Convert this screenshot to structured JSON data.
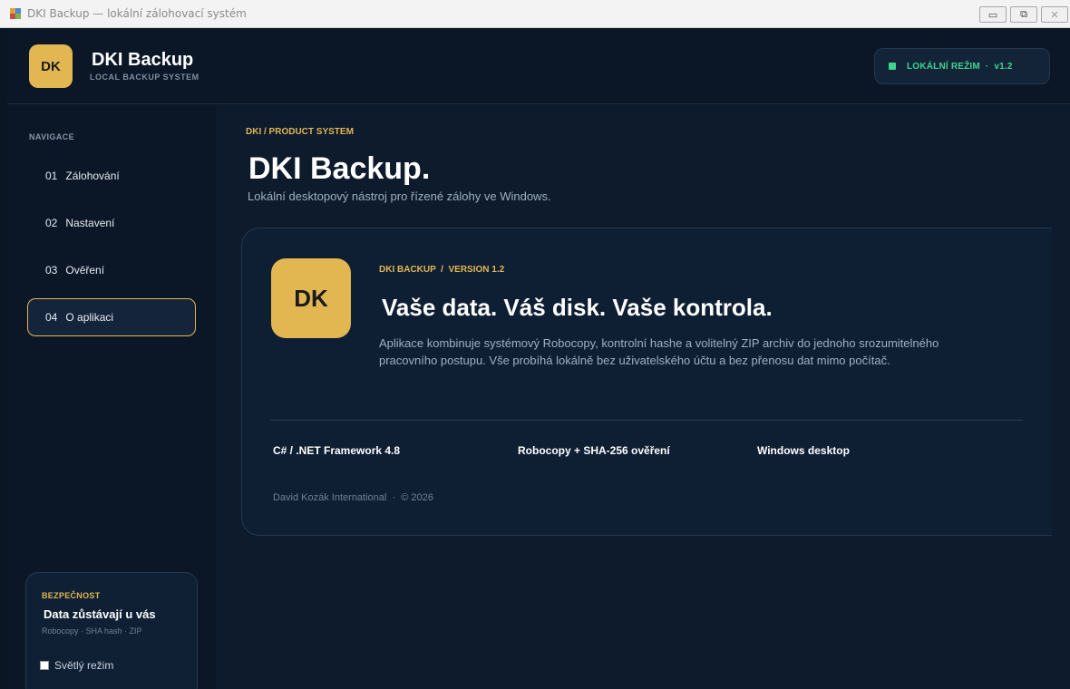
{
  "window": {
    "title": "DKI Backup — lokální zálohovací systém",
    "controls": {
      "minimize": "▭",
      "maximize": "⧉",
      "close": "✕"
    }
  },
  "header": {
    "logo_text": "DK",
    "brand_title": "DKI Backup",
    "brand_subtitle": "LOCAL BACKUP SYSTEM",
    "mode_badge": "LOKÁLNÍ REŽIM  ·  v1.2"
  },
  "sidebar": {
    "nav_title": "NAVIGACE",
    "items": [
      {
        "num": "01",
        "label": "Zálohování",
        "active": false
      },
      {
        "num": "02",
        "label": "Nastavení",
        "active": false
      },
      {
        "num": "03",
        "label": "Ověření",
        "active": false
      },
      {
        "num": "04",
        "label": "O aplikaci",
        "active": true
      }
    ],
    "security": {
      "label": "BEZPEČNOST",
      "title": "Data zůstávají u vás",
      "subtitle": "Robocopy · SHA hash · ZIP",
      "light_mode_label": "Světlý režim",
      "light_mode_checked": false
    }
  },
  "main": {
    "breadcrumb": "DKI / PRODUCT SYSTEM",
    "title": "DKI Backup.",
    "description": "Lokální desktopový nástroj pro řízené zálohy ve Windows.",
    "card": {
      "logo_text": "DK",
      "kicker": "DKI BACKUP  /  VERSION 1.2",
      "headline": "Vaše data. Váš disk. Vaše kontrola.",
      "text": "Aplikace kombinuje systémový Robocopy, kontrolní hashe a volitelný ZIP archiv do jednoho srozumitelného pracovního postupu. Vše probíhá lokálně bez uživatelského účtu a bez přenosu dat mimo počítač.",
      "tech": [
        "C# / .NET Framework 4.8",
        "Robocopy + SHA-256 ověření",
        "Windows desktop"
      ],
      "footer": "David Kozák International  ·  © 2026"
    }
  },
  "colors": {
    "accent": "#e2b651",
    "status_green": "#3dd68c",
    "background": "#0d1b2c"
  }
}
